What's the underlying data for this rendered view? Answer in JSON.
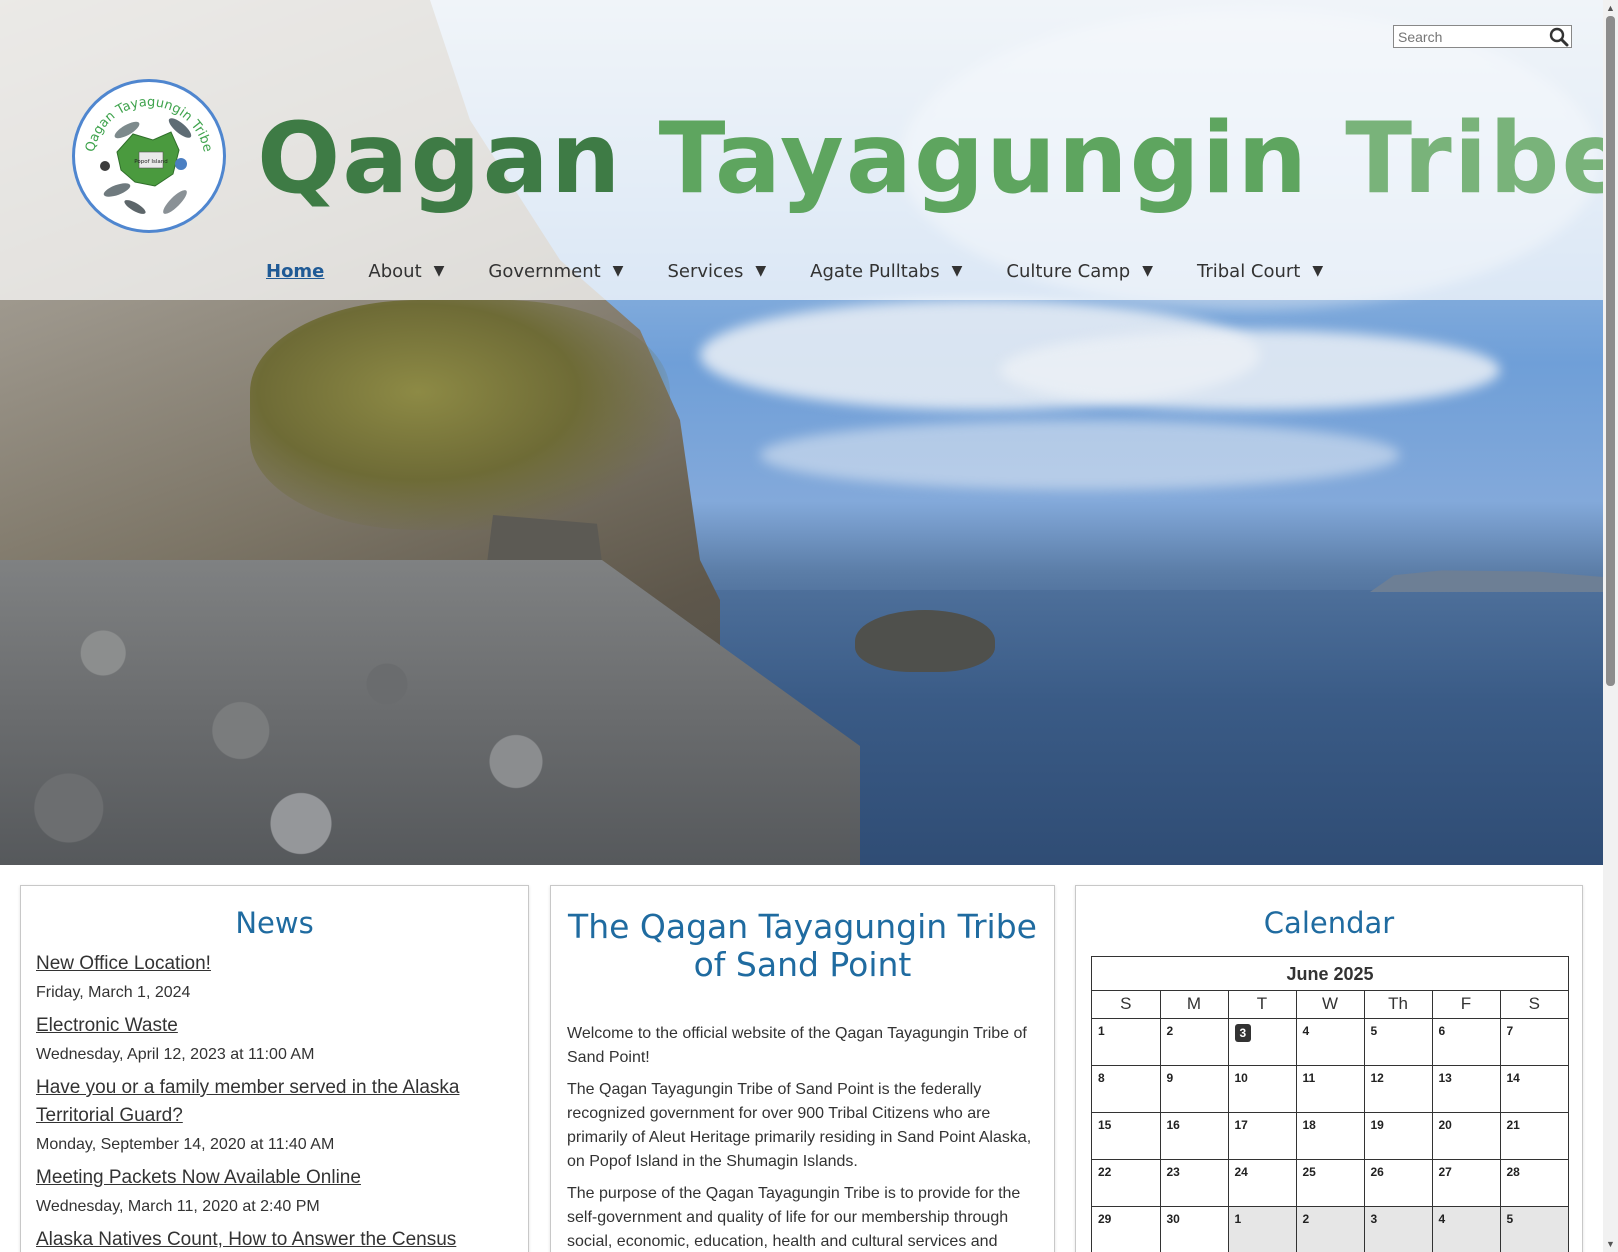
{
  "search": {
    "placeholder": "Search"
  },
  "site": {
    "title_word1": "Qagan",
    "title_word2": "Tayagungin",
    "title_word3": "Tribe",
    "logo_text": "Qagan Tayagungin Tribe",
    "logo_inner_text": "Popof Island"
  },
  "nav": {
    "items": [
      {
        "label": "Home"
      },
      {
        "label": "About"
      },
      {
        "label": "Government"
      },
      {
        "label": "Services"
      },
      {
        "label": "Agate Pulltabs"
      },
      {
        "label": "Culture Camp"
      },
      {
        "label": "Tribal Court"
      }
    ],
    "caret": "▼"
  },
  "news": {
    "heading": "News",
    "items": [
      {
        "title": "New Office Location!",
        "date": "Friday, March 1, 2024"
      },
      {
        "title": "Electronic Waste",
        "date": "Wednesday, April 12, 2023 at 11:00 AM"
      },
      {
        "title": "Have you or a family member served in the Alaska Territorial Guard?",
        "date": "Monday, September 14, 2020 at 11:40 AM"
      },
      {
        "title": "Meeting Packets Now Available Online",
        "date": "Wednesday, March 11, 2020 at 2:40 PM"
      },
      {
        "title": "Alaska Natives Count, How to Answer the Census",
        "date": ""
      }
    ]
  },
  "intro": {
    "heading": "The Qagan Tayagungin Tribe of Sand Point",
    "paragraphs": [
      "Welcome to the official website of the Qagan Tayagungin Tribe of Sand Point!",
      "The Qagan Tayagungin Tribe of Sand Point is the federally recognized government for over 900 Tribal Citizens who are primarily of Aleut Heritage primarily residing in Sand Point Alaska, on Popof Island in the Shumagin Islands.",
      "The purpose of the Qagan Tayagungin Tribe is to provide for the self-government and quality of life for our membership through social, economic, education, health and cultural services and"
    ]
  },
  "calendar": {
    "heading": "Calendar",
    "month": "June 2025",
    "weekdays": [
      "S",
      "M",
      "T",
      "W",
      "Th",
      "F",
      "S"
    ],
    "weeks": [
      [
        "1",
        "2",
        "3",
        "4",
        "5",
        "6",
        "7"
      ],
      [
        "8",
        "9",
        "10",
        "11",
        "12",
        "13",
        "14"
      ],
      [
        "15",
        "16",
        "17",
        "18",
        "19",
        "20",
        "21"
      ],
      [
        "22",
        "23",
        "24",
        "25",
        "26",
        "27",
        "28"
      ],
      [
        "29",
        "30",
        "1",
        "2",
        "3",
        "4",
        "5"
      ]
    ],
    "today": "3"
  },
  "colors": {
    "title_dark_green": "#3e7b45",
    "title_mid_green": "#5ea55f",
    "title_light_green": "#79b37a",
    "heading_blue": "#1f6ba0",
    "logo_border": "#4f86cf"
  },
  "icons": {
    "search": "search-icon",
    "caret": "caret-down-icon"
  }
}
